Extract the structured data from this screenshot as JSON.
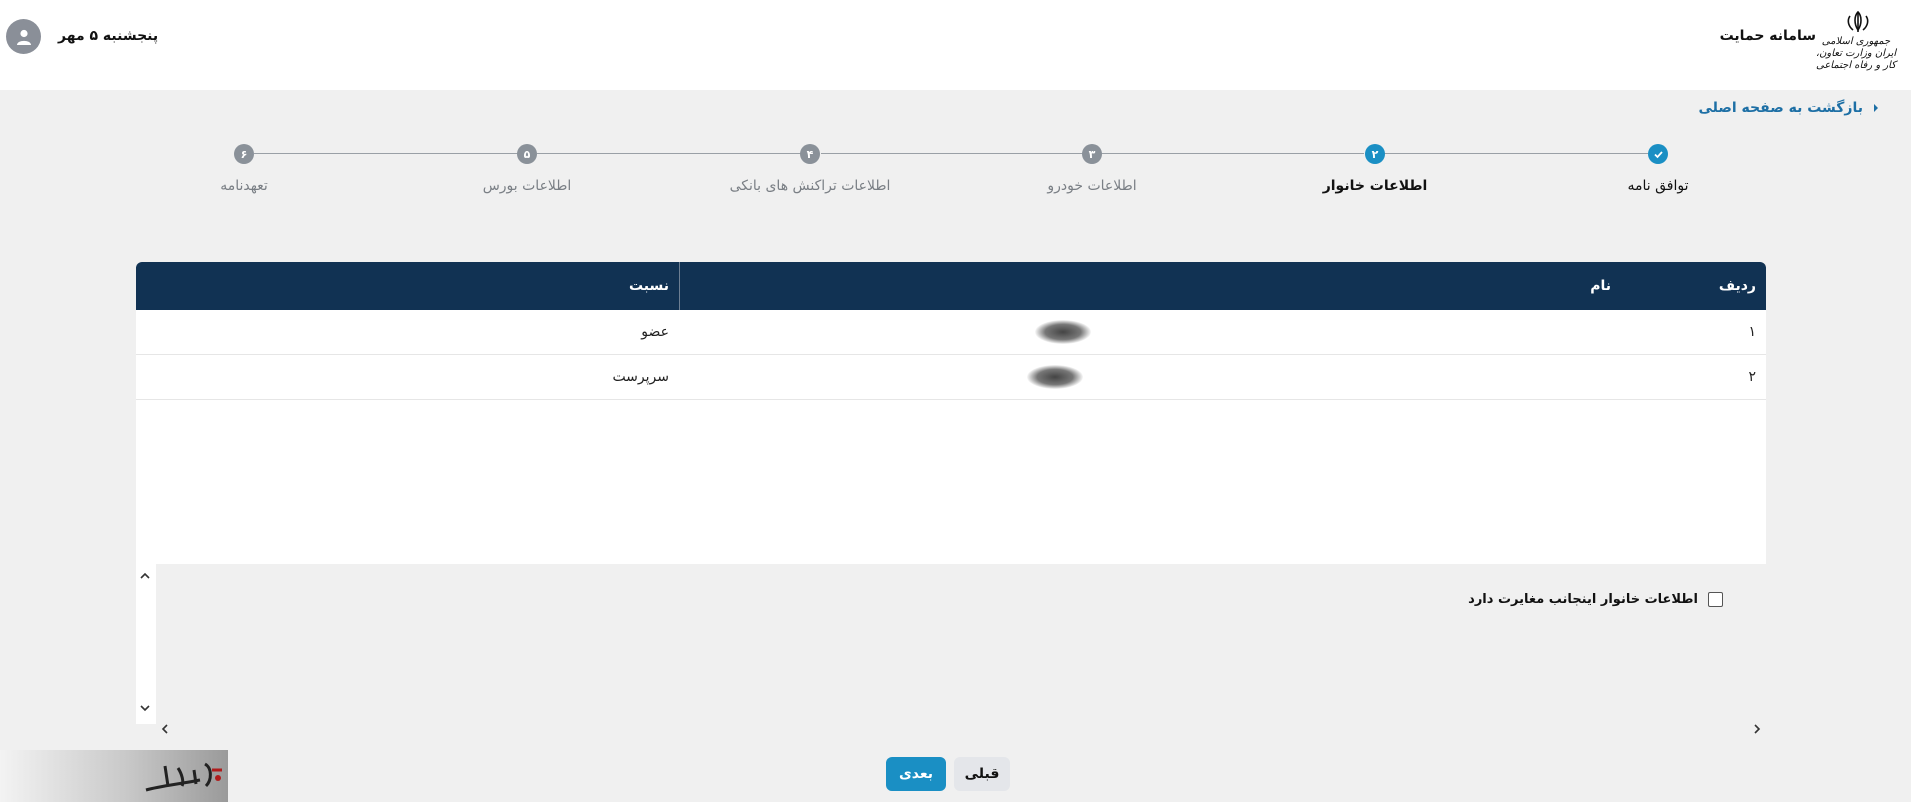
{
  "header": {
    "app_title": "سامانه حمایت",
    "ministry_text": "جمهوری اسلامی ایران وزارت تعاون، کار و رفاه اجتماعی",
    "date": "پنجشنبه ۵ مهر"
  },
  "back_link": {
    "label": "بازگشت به صفحه اصلی"
  },
  "stepper": {
    "steps": [
      {
        "number": "✓",
        "label": "توافق نامه",
        "state": "done"
      },
      {
        "number": "۲",
        "label": "اطلاعات خانوار",
        "state": "active"
      },
      {
        "number": "۳",
        "label": "اطلاعات خودرو",
        "state": "pending"
      },
      {
        "number": "۴",
        "label": "اطلاعات تراکنش های بانکی",
        "state": "pending"
      },
      {
        "number": "۵",
        "label": "اطلاعات بورس",
        "state": "pending"
      },
      {
        "number": "۶",
        "label": "تعهدنامه",
        "state": "pending"
      }
    ]
  },
  "table": {
    "headers": {
      "row": "ردیف",
      "name": "نام",
      "relation": "نسبت"
    },
    "rows": [
      {
        "row": "۱",
        "relation": "عضو"
      },
      {
        "row": "۲",
        "relation": "سرپرست"
      }
    ]
  },
  "checkbox": {
    "label": "اطلاعات خانوار اینجانب مغایرت دارد",
    "checked": false
  },
  "buttons": {
    "next": "بعدی",
    "prev": "قبلی"
  },
  "colors": {
    "accent": "#1a8fc4",
    "table_header": "#113253",
    "background": "#f0f0f0"
  },
  "icons": [
    "emblem-icon",
    "user-icon",
    "chevron-right-icon",
    "check-icon",
    "chevron-up-icon",
    "chevron-down-icon",
    "chevron-left-icon"
  ]
}
